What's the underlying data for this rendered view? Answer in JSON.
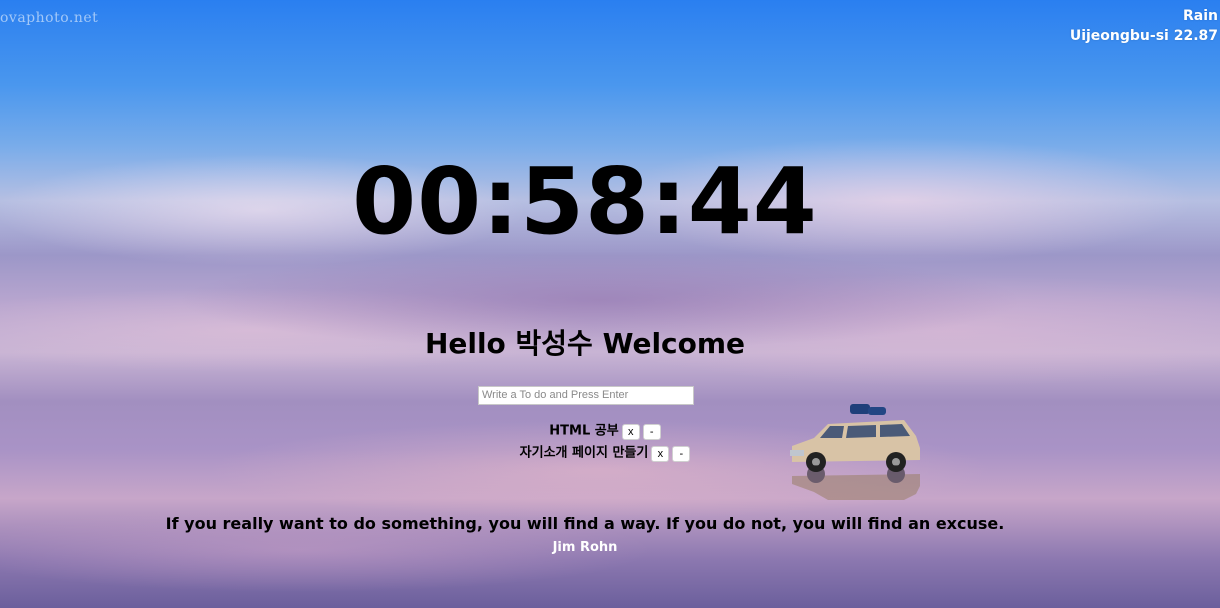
{
  "background": {
    "watermark": "ovaphoto.net"
  },
  "weather": {
    "condition": "Rain",
    "location_temp": "Uijeongbu-si 22.87"
  },
  "clock": {
    "time": "00:58:44"
  },
  "greeting": {
    "text": "Hello 박성수 Welcome"
  },
  "todo": {
    "placeholder": "Write a To do and Press Enter",
    "value": "",
    "items": [
      {
        "text": "HTML 공부",
        "delete_label": "x",
        "minus_label": "-"
      },
      {
        "text": "자기소개 페이지 만들기",
        "delete_label": "x",
        "minus_label": "-"
      }
    ]
  },
  "quote": {
    "text": "If you really want to do something, you will find a way. If you do not, you will find an excuse.",
    "author": "Jim Rohn"
  }
}
